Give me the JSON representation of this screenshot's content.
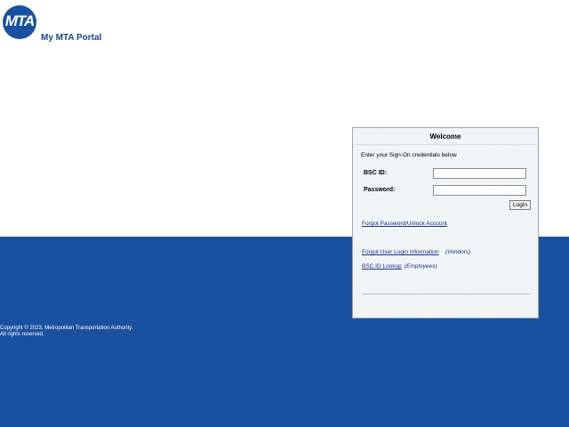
{
  "header": {
    "logo_text": "MTA",
    "portal_title": "My MTA Portal"
  },
  "login": {
    "title": "Welcome",
    "instructions": "Enter your Sign-On credentials below",
    "bsc_id_label": "BSC ID:",
    "bsc_id_value": "",
    "password_label": "Password:",
    "password_value": "",
    "login_button": "Login",
    "forgot_password_link": "Forgot Password/Unlock Account",
    "forgot_user_link": "Forgot User Login Information",
    "vendors_note": "(Vendors)",
    "bsc_lookup_link": "BSC ID Lookup",
    "employees_note": "(Employees)"
  },
  "footer": {
    "copyright_line1": "Copyright © 2023, Metropolitan Transportation Authority.",
    "copyright_line2": "All rights reserved."
  },
  "colors": {
    "brand_blue": "#1a50a0",
    "title_blue": "#1a4790",
    "link_blue": "#1a2f8a"
  }
}
